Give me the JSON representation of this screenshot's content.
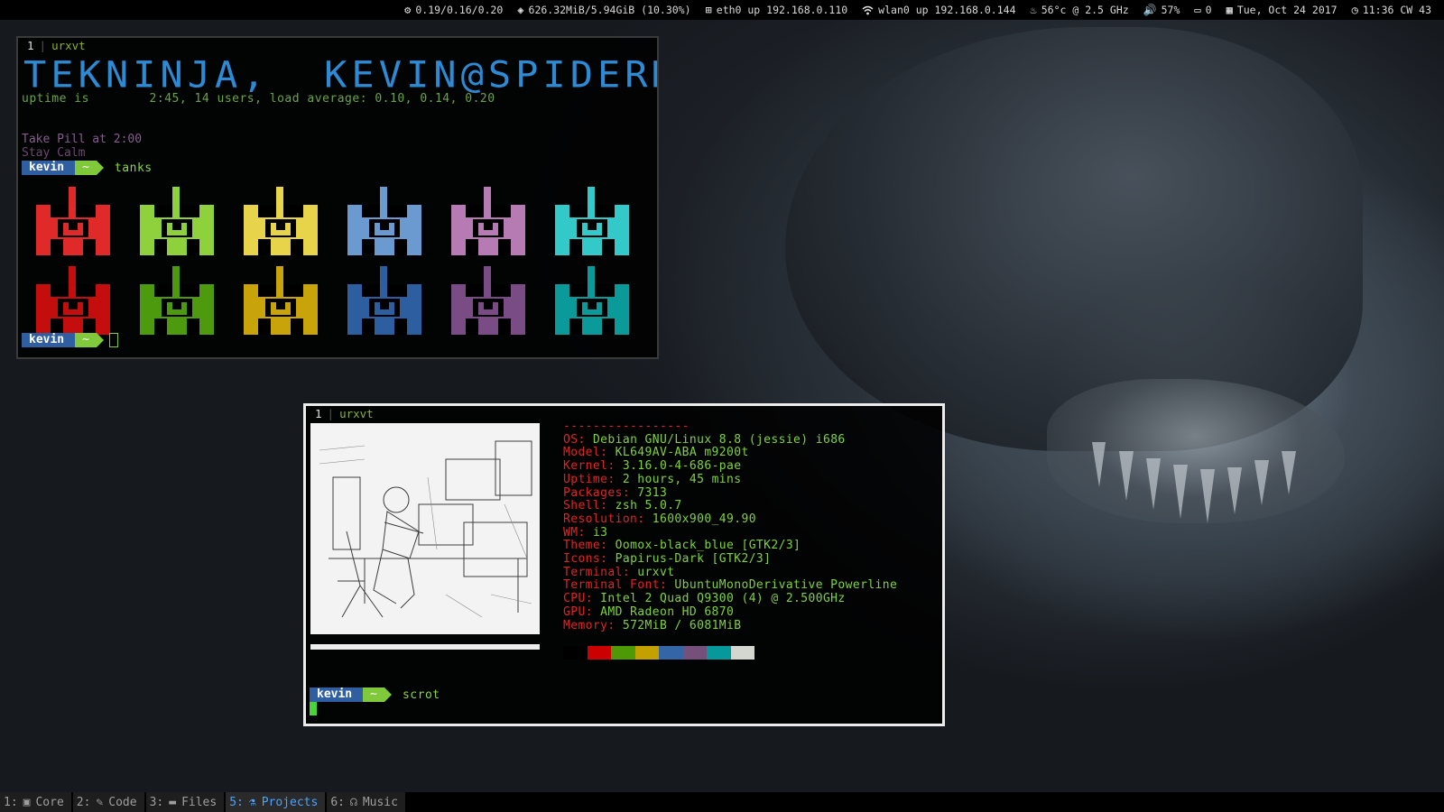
{
  "statusbar": {
    "load": "0.19/0.16/0.20",
    "memory": "626.32MiB/5.94GiB (10.30%)",
    "eth": "eth0 up 192.168.0.110",
    "wlan": "wlan0 up 192.168.0.144",
    "cpu_temp": "56°c @ 2.5 GHz",
    "volume": "57%",
    "notifications": "0",
    "date": "Tue, Oct 24 2017",
    "time": "11:36 CW 43",
    "icons": {
      "load": "gears-icon",
      "memory": "memory-icon",
      "eth": "network-icon",
      "wlan": "wifi-icon",
      "temp": "flame-icon",
      "volume": "speaker-icon",
      "notif": "note-icon",
      "date": "calendar-icon",
      "time": "clock-icon"
    }
  },
  "term1": {
    "tab_num": "1",
    "tab_name": "urxvt",
    "banner": "TEKNINJA,  KEVIN@SPIDERMANPC",
    "uptime_line": "uptime is        2:45, 14 users, load average: 0.10, 0.14, 0.20",
    "note1": "Take Pill at 2:00",
    "note2": "Stay Calm",
    "prompt_user": "kevin",
    "prompt_dir": "~",
    "command": "tanks",
    "prompt2_user": "kevin",
    "prompt2_dir": "~",
    "tank_colors_row1": [
      "#e02a2a",
      "#8fd13c",
      "#e8d44a",
      "#6a9ad0",
      "#b57bb2",
      "#33c9c9"
    ],
    "tank_colors_row2": [
      "#c40d0d",
      "#4d9a0e",
      "#c9a30a",
      "#2d5fa0",
      "#7a4c85",
      "#0a9a9a"
    ]
  },
  "term2": {
    "tab_num": "1",
    "tab_name": "urxvt",
    "divider": "-----------------",
    "info": [
      {
        "key": "OS",
        "value": "Debian GNU/Linux 8.8 (jessie) i686"
      },
      {
        "key": "Model",
        "value": "KL649AV-ABA m9200t"
      },
      {
        "key": "Kernel",
        "value": "3.16.0-4-686-pae"
      },
      {
        "key": "Uptime",
        "value": "2 hours, 45 mins"
      },
      {
        "key": "Packages",
        "value": "7313"
      },
      {
        "key": "Shell",
        "value": "zsh 5.0.7"
      },
      {
        "key": "Resolution",
        "value": "1600x900_49.90"
      },
      {
        "key": "WM",
        "value": "i3"
      },
      {
        "key": "Theme",
        "value": "Oomox-black_blue [GTK2/3]"
      },
      {
        "key": "Icons",
        "value": "Papirus-Dark [GTK2/3]"
      },
      {
        "key": "Terminal",
        "value": "urxvt"
      },
      {
        "key": "Terminal Font",
        "value": "UbuntuMonoDerivative Powerline"
      },
      {
        "key": "CPU",
        "value": "Intel 2 Quad Q9300 (4) @ 2.500GHz"
      },
      {
        "key": "GPU",
        "value": "AMD Radeon HD 6870"
      },
      {
        "key": "Memory",
        "value": "572MiB / 6081MiB"
      }
    ],
    "swatch_colors": [
      "#000000",
      "#cc0000",
      "#4e9a06",
      "#c4a000",
      "#3465a4",
      "#75507b",
      "#06989a",
      "#d3d7cf"
    ],
    "prompt_user": "kevin",
    "prompt_dir": "~",
    "command": "scrot"
  },
  "workspaces": [
    {
      "num": "1:",
      "icon": "terminal-icon",
      "label": "Core",
      "active": false
    },
    {
      "num": "2:",
      "icon": "code-icon",
      "label": "Code",
      "active": false
    },
    {
      "num": "3:",
      "icon": "folder-icon",
      "label": "Files",
      "active": false
    },
    {
      "num": "5:",
      "icon": "flask-icon",
      "label": "Projects",
      "active": true
    },
    {
      "num": "6:",
      "icon": "headphones-icon",
      "label": "Music",
      "active": false
    }
  ]
}
